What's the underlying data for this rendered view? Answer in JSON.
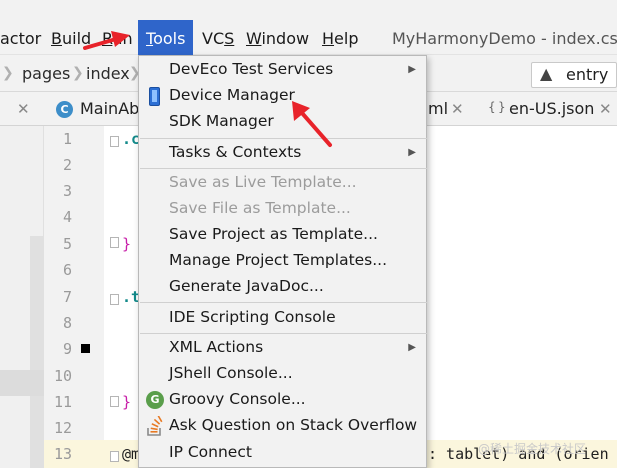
{
  "menubar": {
    "items": [
      {
        "label": "actor"
      },
      {
        "prefix": "",
        "underline": "B",
        "rest": "uild"
      },
      {
        "prefix": "",
        "underline": "R",
        "rest": "un"
      },
      {
        "prefix": "",
        "underline": "T",
        "rest": "ools"
      },
      {
        "prefix": "VC",
        "underline": "S",
        "rest": ""
      },
      {
        "prefix": "",
        "underline": "W",
        "rest": "indow"
      },
      {
        "prefix": "",
        "underline": "H",
        "rest": "elp"
      }
    ],
    "window_title": "MyHarmonyDemo - index.css [e"
  },
  "navbar": {
    "crumbs": [
      "pages",
      "index"
    ],
    "run_config": "entry",
    "run_config_icon": "module-icon"
  },
  "tabs": [
    {
      "label": "MainAb"
    },
    {
      "label": "ml"
    },
    {
      "label": "en-US.json"
    }
  ],
  "editor": {
    "line_numbers": [
      "1",
      "2",
      "3",
      "4",
      "5",
      "6",
      "7",
      "8",
      "9",
      "10",
      "11",
      "12",
      "13"
    ],
    "code": {
      "line1": ".c",
      "line5": "}",
      "line7": ".t",
      "line11": "}",
      "line13_prefix": "@m",
      "line13_rest": ": tablet) and (orien"
    }
  },
  "tools_menu": {
    "items": [
      {
        "label": "DevEco Test Services",
        "submenu": true,
        "enabled": true
      },
      {
        "label": "Device Manager",
        "enabled": true,
        "icon": "device-icon"
      },
      {
        "label": "SDK Manager",
        "enabled": true
      },
      {
        "label": "Tasks & Contexts",
        "submenu": true,
        "enabled": true
      },
      {
        "label": "Save as Live Template...",
        "enabled": false
      },
      {
        "label": "Save File as Template...",
        "enabled": false
      },
      {
        "label": "Save Project as Template...",
        "enabled": true
      },
      {
        "label": "Manage Project Templates...",
        "enabled": true
      },
      {
        "label": "Generate JavaDoc...",
        "enabled": true
      },
      {
        "label": "IDE Scripting Console",
        "enabled": true
      },
      {
        "label": "XML Actions",
        "submenu": true,
        "enabled": true
      },
      {
        "label": "JShell Console...",
        "enabled": true
      },
      {
        "label": "Groovy Console...",
        "enabled": true,
        "icon": "groovy-icon"
      },
      {
        "label": "Ask Question on Stack Overflow",
        "enabled": true,
        "icon": "stack-overflow-icon"
      },
      {
        "label": "IP Connect",
        "enabled": true
      }
    ]
  },
  "watermark": "@稀土掘金技术社区",
  "colors": {
    "accent": "#2f65ca",
    "annotation_arrow": "#e8232a",
    "current_line": "#fbf6dd"
  }
}
